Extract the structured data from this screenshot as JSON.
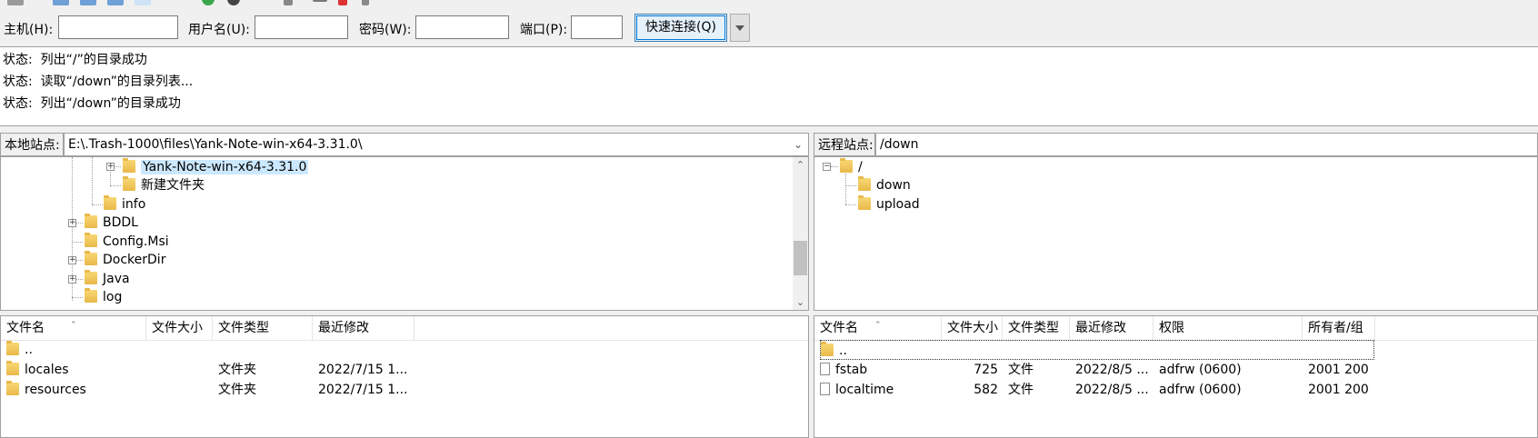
{
  "quickconnect": {
    "host_label": "主机(H):",
    "host_value": "",
    "user_label": "用户名(U):",
    "user_value": "",
    "pass_label": "密码(W):",
    "pass_value": "",
    "port_label": "端口(P):",
    "port_value": "",
    "connect_button": "快速连接(Q)"
  },
  "log": [
    {
      "prefix": "状态:",
      "message": "列出“/”的目录成功"
    },
    {
      "prefix": "状态:",
      "message": "读取“/down”的目录列表..."
    },
    {
      "prefix": "状态:",
      "message": "列出“/down”的目录成功"
    }
  ],
  "local": {
    "site_label": "本地站点:",
    "site_path": "E:\\.Trash-1000\\files\\Yank-Note-win-x64-3.31.0\\",
    "tree": [
      {
        "label": "Yank-Note-win-x64-3.31.0",
        "selected": true
      },
      {
        "label": "新建文件夹"
      },
      {
        "label": "info"
      },
      {
        "label": "BDDL"
      },
      {
        "label": "Config.Msi"
      },
      {
        "label": "DockerDir"
      },
      {
        "label": "Java"
      },
      {
        "label": "log"
      }
    ],
    "columns": {
      "name": "文件名",
      "size": "文件大小",
      "type": "文件类型",
      "modified": "最近修改"
    },
    "files": [
      {
        "name": "..",
        "size": "",
        "type": "",
        "modified": ""
      },
      {
        "name": "locales",
        "size": "",
        "type": "文件夹",
        "modified": "2022/7/15 1..."
      },
      {
        "name": "resources",
        "size": "",
        "type": "文件夹",
        "modified": "2022/7/15 1..."
      }
    ]
  },
  "remote": {
    "site_label": "远程站点:",
    "site_path": "/down",
    "tree": [
      {
        "label": "/"
      },
      {
        "label": "down"
      },
      {
        "label": "upload"
      }
    ],
    "columns": {
      "name": "文件名",
      "size": "文件大小",
      "type": "文件类型",
      "modified": "最近修改",
      "perms": "权限",
      "owner": "所有者/组"
    },
    "files": [
      {
        "name": "..",
        "size": "",
        "type": "",
        "modified": "",
        "perms": "",
        "owner": ""
      },
      {
        "name": "fstab",
        "size": "725",
        "type": "文件",
        "modified": "2022/8/5 ...",
        "perms": "adfrw (0600)",
        "owner": "2001 200"
      },
      {
        "name": "localtime",
        "size": "582",
        "type": "文件",
        "modified": "2022/8/5 ...",
        "perms": "adfrw (0600)",
        "owner": "2001 200"
      }
    ]
  },
  "colors": {
    "accent": "#0078d7",
    "folder": "#f8d775",
    "selection": "#cce8ff"
  }
}
